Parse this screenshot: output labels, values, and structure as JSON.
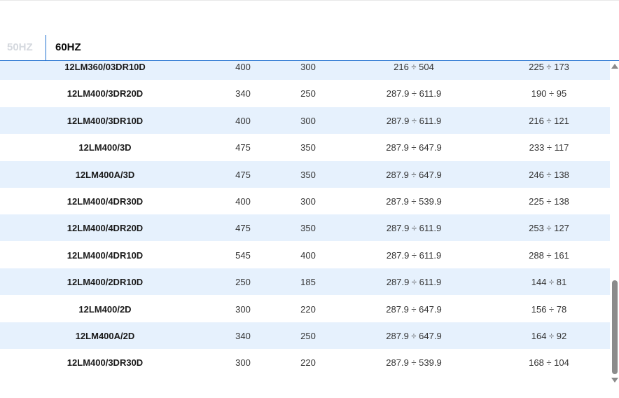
{
  "tabs": [
    {
      "label": "50HZ",
      "active": false
    },
    {
      "label": "60HZ",
      "active": true
    }
  ],
  "table": {
    "rows": [
      [
        "12LM360/03DR10D",
        "400",
        "300",
        "216 ÷ 504",
        "225 ÷ 173"
      ],
      [
        "12LM400/3DR20D",
        "340",
        "250",
        "287.9 ÷ 611.9",
        "190 ÷ 95"
      ],
      [
        "12LM400/3DR10D",
        "400",
        "300",
        "287.9 ÷ 611.9",
        "216 ÷ 121"
      ],
      [
        "12LM400/3D",
        "475",
        "350",
        "287.9 ÷ 647.9",
        "233 ÷ 117"
      ],
      [
        "12LM400A/3D",
        "475",
        "350",
        "287.9 ÷ 647.9",
        "246 ÷ 138"
      ],
      [
        "12LM400/4DR30D",
        "400",
        "300",
        "287.9 ÷ 539.9",
        "225 ÷ 138"
      ],
      [
        "12LM400/4DR20D",
        "475",
        "350",
        "287.9 ÷ 611.9",
        "253 ÷ 127"
      ],
      [
        "12LM400/4DR10D",
        "545",
        "400",
        "287.9 ÷ 611.9",
        "288 ÷ 161"
      ],
      [
        "12LM400/2DR10D",
        "250",
        "185",
        "287.9 ÷ 611.9",
        "144 ÷ 81"
      ],
      [
        "12LM400/2D",
        "300",
        "220",
        "287.9 ÷ 647.9",
        "156 ÷ 78"
      ],
      [
        "12LM400A/2D",
        "340",
        "250",
        "287.9 ÷ 647.9",
        "164 ÷ 92"
      ],
      [
        "12LM400/3DR30D",
        "300",
        "220",
        "287.9 ÷ 539.9",
        "168 ÷ 104"
      ]
    ]
  },
  "colors": {
    "accent": "#1e6fd0",
    "row_alt": "#e6f1fd",
    "tab_inactive": "#d4d8de"
  }
}
